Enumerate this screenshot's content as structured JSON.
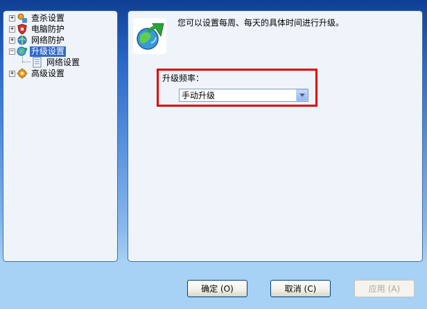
{
  "tree": {
    "items": [
      {
        "label": "查杀设置",
        "expander": "+",
        "icon": "scan-shield-icon"
      },
      {
        "label": "电脑防护",
        "expander": "+",
        "icon": "computer-protection-icon"
      },
      {
        "label": "网络防护",
        "expander": "+",
        "icon": "network-protection-icon"
      },
      {
        "label": "升级设置",
        "expander": "−",
        "icon": "update-globe-icon",
        "selected": true
      },
      {
        "label": "网络设置",
        "icon": "settings-page-icon"
      },
      {
        "label": "高级设置",
        "expander": "+",
        "icon": "advanced-gear-icon"
      }
    ]
  },
  "content": {
    "header_text": "您可以设置每周、每天的具体时间进行升级。",
    "frequency_label": "升级频率：",
    "frequency_value": "手动升级"
  },
  "buttons": {
    "ok": "确定 (O)",
    "cancel": "取消 (C)",
    "apply": "应用 (A)"
  },
  "colors": {
    "highlight_border": "#e00000",
    "selection": "#3169c6"
  }
}
